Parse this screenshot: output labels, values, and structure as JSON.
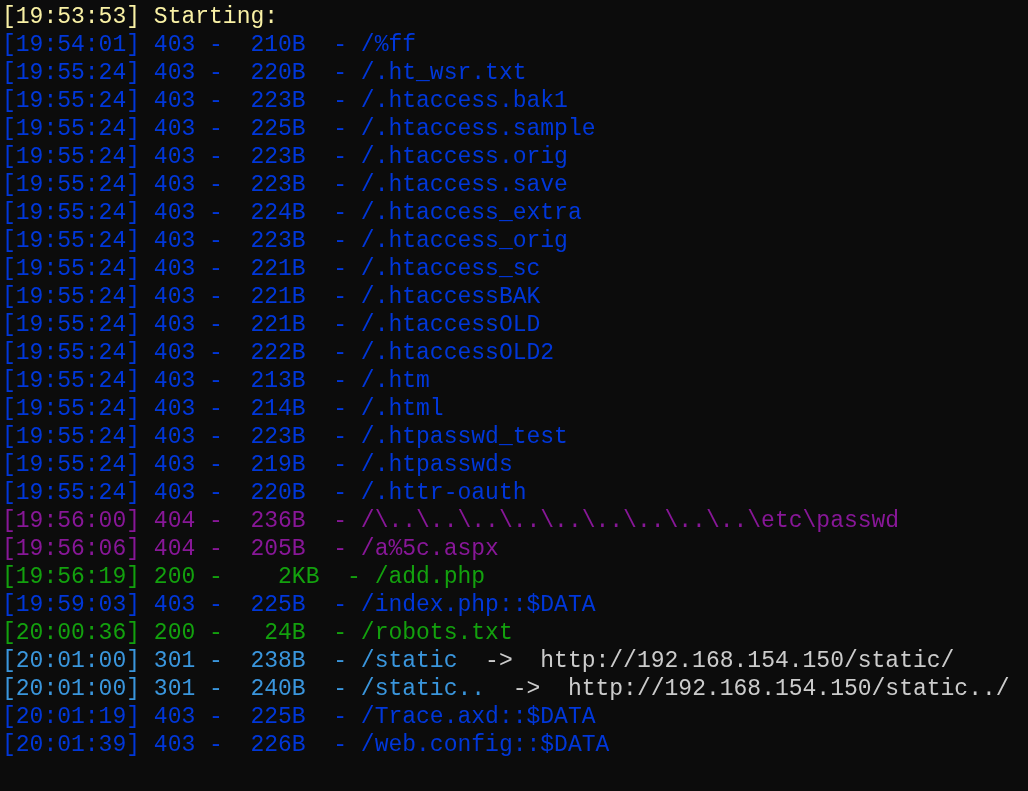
{
  "lines": [
    {
      "text": "[19:53:53] Starting:",
      "color": "#f9f1a5"
    },
    {
      "text": "[19:54:01] 403 -  210B  - /%ff",
      "color": "#0037da"
    },
    {
      "text": "[19:55:24] 403 -  220B  - /.ht_wsr.txt",
      "color": "#0037da"
    },
    {
      "text": "[19:55:24] 403 -  223B  - /.htaccess.bak1",
      "color": "#0037da"
    },
    {
      "text": "[19:55:24] 403 -  225B  - /.htaccess.sample",
      "color": "#0037da"
    },
    {
      "text": "[19:55:24] 403 -  223B  - /.htaccess.orig",
      "color": "#0037da"
    },
    {
      "text": "[19:55:24] 403 -  223B  - /.htaccess.save",
      "color": "#0037da"
    },
    {
      "text": "[19:55:24] 403 -  224B  - /.htaccess_extra",
      "color": "#0037da"
    },
    {
      "text": "[19:55:24] 403 -  223B  - /.htaccess_orig",
      "color": "#0037da"
    },
    {
      "text": "[19:55:24] 403 -  221B  - /.htaccess_sc",
      "color": "#0037da"
    },
    {
      "text": "[19:55:24] 403 -  221B  - /.htaccessBAK",
      "color": "#0037da"
    },
    {
      "text": "[19:55:24] 403 -  221B  - /.htaccessOLD",
      "color": "#0037da"
    },
    {
      "text": "[19:55:24] 403 -  222B  - /.htaccessOLD2",
      "color": "#0037da"
    },
    {
      "text": "[19:55:24] 403 -  213B  - /.htm",
      "color": "#0037da"
    },
    {
      "text": "[19:55:24] 403 -  214B  - /.html",
      "color": "#0037da"
    },
    {
      "text": "[19:55:24] 403 -  223B  - /.htpasswd_test",
      "color": "#0037da"
    },
    {
      "text": "[19:55:24] 403 -  219B  - /.htpasswds",
      "color": "#0037da"
    },
    {
      "text": "[19:55:24] 403 -  220B  - /.httr-oauth",
      "color": "#0037da"
    },
    {
      "text": "[19:56:00] 404 -  236B  - /\\..\\..\\..\\..\\..\\..\\..\\..\\..\\etc\\passwd",
      "color": "#881798"
    },
    {
      "text": "[19:56:06] 404 -  205B  - /a%5c.aspx",
      "color": "#881798"
    },
    {
      "text": "[19:56:19] 200 -    2KB  - /add.php",
      "color": "#13a10e"
    },
    {
      "text": "[19:59:03] 403 -  225B  - /index.php::$DATA",
      "color": "#0037da"
    },
    {
      "text": "[20:00:36] 200 -   24B  - /robots.txt",
      "color": "#13a10e"
    },
    {
      "text": "[20:01:00] 301 -  238B  - /static",
      "color": "#3a96dd",
      "redirect": "  ->  http://192.168.154.150/static/"
    },
    {
      "text": "[20:01:00] 301 -  240B  - /static..",
      "color": "#3a96dd",
      "redirect": "  ->  http://192.168.154.150/static../"
    },
    {
      "text": "[20:01:19] 403 -  225B  - /Trace.axd::$DATA",
      "color": "#0037da"
    },
    {
      "text": "[20:01:39] 403 -  226B  - /web.config::$DATA",
      "color": "#0037da"
    }
  ]
}
